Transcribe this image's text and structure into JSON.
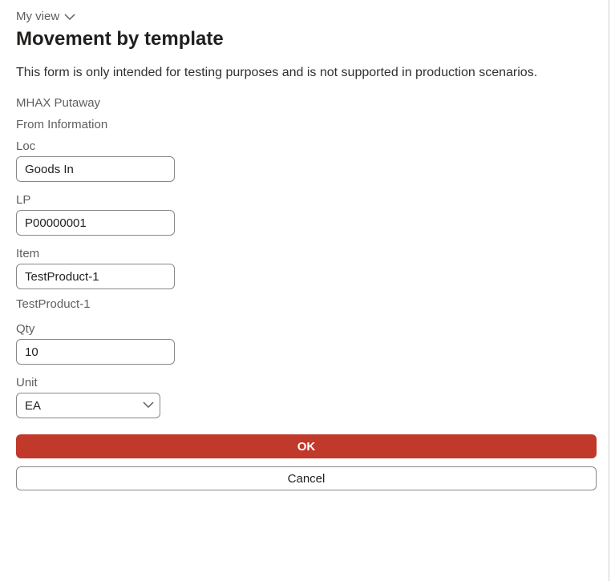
{
  "view": {
    "label": "My view"
  },
  "title": "Movement by template",
  "warning": "This form is only intended for testing purposes and is not supported in production scenarios.",
  "context": "MHAX Putaway",
  "section": "From Information",
  "fields": {
    "loc": {
      "label": "Loc",
      "value": "Goods In"
    },
    "lp": {
      "label": "LP",
      "value": "P00000001"
    },
    "item": {
      "label": "Item",
      "value": "TestProduct-1",
      "description": "TestProduct-1"
    },
    "qty": {
      "label": "Qty",
      "value": "10"
    },
    "unit": {
      "label": "Unit",
      "value": "EA"
    }
  },
  "buttons": {
    "ok": "OK",
    "cancel": "Cancel"
  }
}
